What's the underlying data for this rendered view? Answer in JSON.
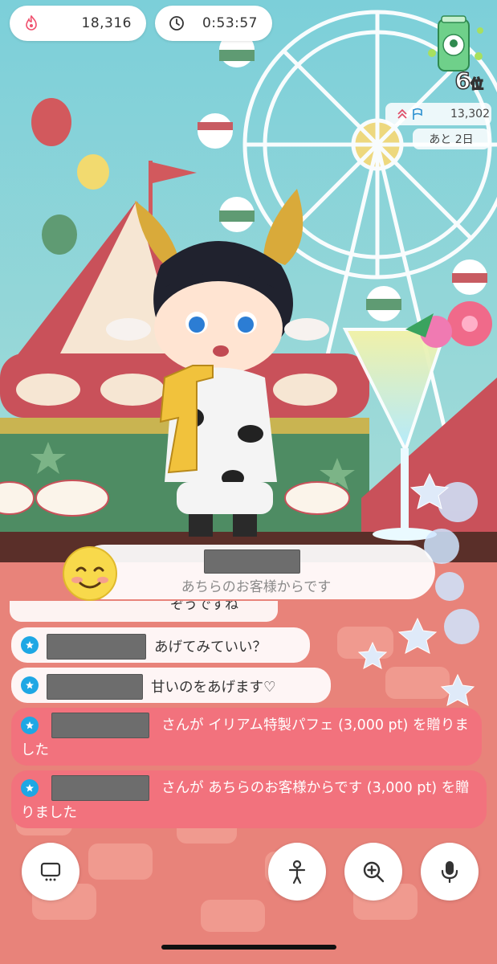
{
  "status": {
    "fire_count": "18,316",
    "timer": "0:53:57"
  },
  "ranking": {
    "rank": "6",
    "rank_suffix": "位",
    "points": "13,302",
    "remaining": "あと 2日"
  },
  "gift_popup": {
    "text": "あちらのお客様からです"
  },
  "chat": {
    "truncated_text": "ぞうですね",
    "messages": [
      {
        "text": "あげてみていい？"
      },
      {
        "text": "甘いのをあげます♡"
      },
      {
        "prefix": "さんが",
        "text": "イリアム特製パフェ (3,000 pt) を贈りました"
      },
      {
        "prefix": "さんが",
        "text": "あちらのお客様からです (3,000 pt) を贈りました"
      }
    ]
  },
  "toolbar": {
    "screen_icon": "screen-icon",
    "avatar_icon": "avatar-icon",
    "zoom_icon": "zoom-in-icon",
    "mic_icon": "microphone-icon"
  },
  "colors": {
    "gift_row": "#f2727d",
    "badge": "#1ea7e4",
    "bottom_bg": "#e8837a"
  }
}
